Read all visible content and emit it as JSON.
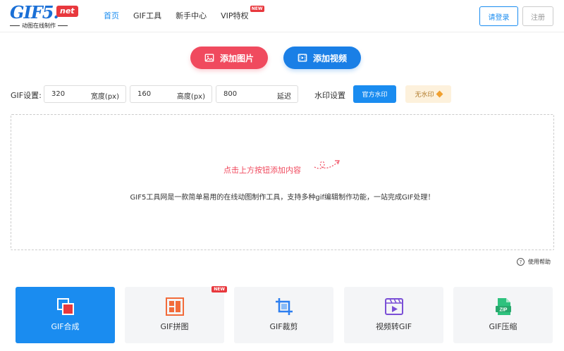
{
  "header": {
    "logo_text": "GIF5.",
    "logo_badge": "net",
    "logo_tagline": "动图在线制作",
    "nav": [
      {
        "label": "首页",
        "active": true
      },
      {
        "label": "GIF工具"
      },
      {
        "label": "新手中心"
      },
      {
        "label": "VIP特权",
        "badge": "NEW"
      }
    ],
    "login_label": "请登录",
    "register_label": "注册"
  },
  "actions": {
    "add_image_label": "添加图片",
    "add_video_label": "添加视频"
  },
  "settings": {
    "label": "GIF设置:",
    "width": {
      "value": "320",
      "unit": "宽度(px)"
    },
    "height": {
      "value": "160",
      "unit": "高度(px)"
    },
    "delay": {
      "value": "800",
      "unit": "延迟"
    },
    "watermark_label": "水印设置",
    "watermark_official": "官方水印",
    "watermark_none": "无水印"
  },
  "dropzone": {
    "hint": "点击上方按钮添加内容",
    "description": "GIF5工具网是一款简单易用的在线动图制作工具，支持多种gif编辑制作功能，一站完成GIF处理！"
  },
  "help_label": "使用帮助",
  "tools": [
    {
      "label": "GIF合成",
      "icon": "merge-icon",
      "active": true
    },
    {
      "label": "GIF拼图",
      "icon": "puzzle-icon",
      "badge": "NEW"
    },
    {
      "label": "GIF裁剪",
      "icon": "crop-icon"
    },
    {
      "label": "视频转GIF",
      "icon": "video-play-icon"
    },
    {
      "label": "GIF压缩",
      "icon": "zip-icon"
    }
  ],
  "colors": {
    "primary": "#1a8cf0",
    "accent_red": "#f04a5e",
    "badge_red": "#e8383d"
  }
}
